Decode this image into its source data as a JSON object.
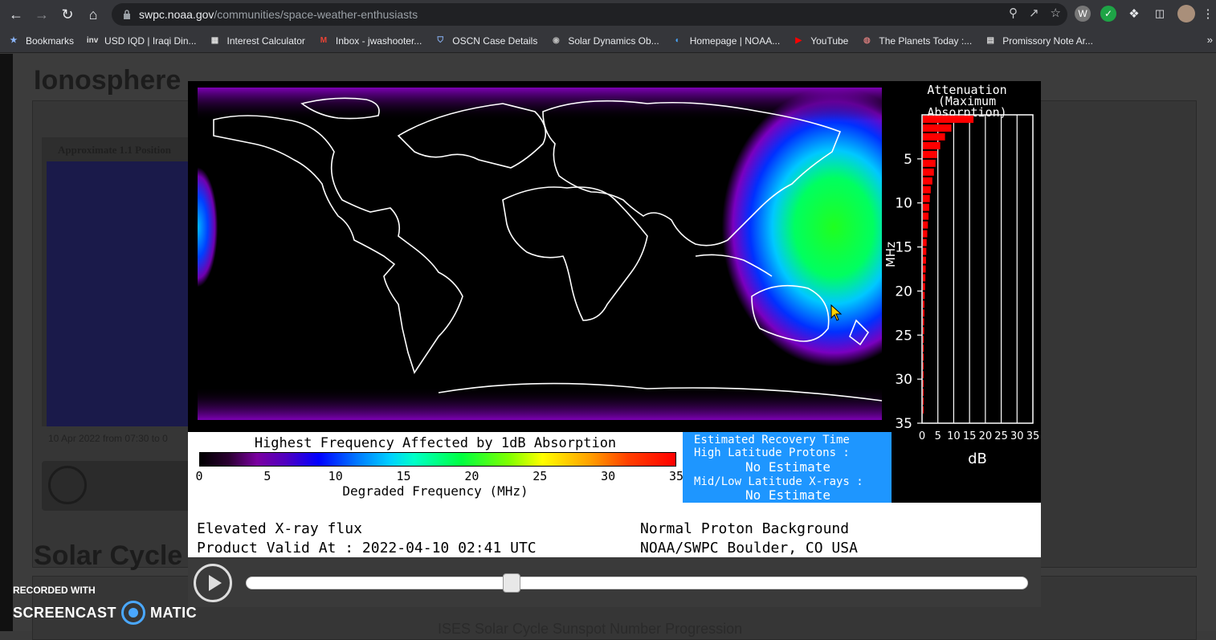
{
  "browser": {
    "url_host": "swpc.noaa.gov",
    "url_path": "/communities/space-weather-enthusiasts",
    "bookmarks": [
      {
        "label": "Bookmarks",
        "icon": "star-icon"
      },
      {
        "label": "USD IQD | Iraqi Din...",
        "icon": "inv-icon"
      },
      {
        "label": "Interest Calculator",
        "icon": "calculator-icon"
      },
      {
        "label": "Inbox - jwashooter...",
        "icon": "gmail-icon"
      },
      {
        "label": "OSCN Case Details",
        "icon": "shield-icon"
      },
      {
        "label": "Solar Dynamics Ob...",
        "icon": "nasa-icon"
      },
      {
        "label": "Homepage | NOAA...",
        "icon": "noaa-icon"
      },
      {
        "label": "YouTube",
        "icon": "youtube-icon"
      },
      {
        "label": "The Planets Today :...",
        "icon": "planet-icon"
      },
      {
        "label": "Promissory Note Ar...",
        "icon": "document-icon"
      }
    ],
    "more": "»"
  },
  "page": {
    "section1_title": "Ionosphere",
    "inner_title": "Approximate 1.1 Position",
    "inner_date": "10 Apr 2022 from 07:30 to 0",
    "section2_title": "Solar Cycle",
    "section2_sub": "ISES Solar Cycle Sunspot Number Progression"
  },
  "drap": {
    "attenuation_title": "Attenuation",
    "attenuation_subtitle": "(Maximum Absorption)",
    "yaxis_label": "MHz",
    "yticks": [
      "5",
      "10",
      "15",
      "20",
      "25",
      "30",
      "35"
    ],
    "xticks": [
      "0",
      "5",
      "10",
      "15",
      "20",
      "25",
      "30",
      "35"
    ],
    "xaxis_label": "dB",
    "legend_title": "Highest Frequency Affected by 1dB Absorption",
    "colorbar_ticks": [
      "0",
      "5",
      "10",
      "15",
      "20",
      "25",
      "30",
      "35"
    ],
    "colorbar_label": "Degraded Frequency (MHz)",
    "recovery_title": "Estimated Recovery Time",
    "high_lat_label": "High Latitude Protons :",
    "high_lat_value": "No Estimate",
    "mid_lat_label": "Mid/Low Latitude X-rays :",
    "mid_lat_value": "No Estimate",
    "status_left": "Elevated X-ray flux",
    "valid_at": "Product Valid At : 2022-04-10 02:41 UTC",
    "status_right": "Normal Proton Background",
    "source": "NOAA/SWPC Boulder, CO USA",
    "slider_position": 0.34,
    "colors": {
      "recovery_bg": "#1e96ff",
      "bar": "#ff0000"
    }
  },
  "attenuation_bars_db": [
    16,
    9,
    7,
    5.5,
    4.5,
    4,
    3.5,
    3,
    2.5,
    2.2,
    2,
    1.8,
    1.6,
    1.4,
    1.2,
    1.1,
    1,
    0.9,
    0.8,
    0.7,
    0.6,
    0.5,
    0.5,
    0.4,
    0.4,
    0.3,
    0.3,
    0.3,
    0.2,
    0.2,
    0.2,
    0.2,
    0.1,
    0.1
  ],
  "watermark": {
    "top": "RECORDED WITH",
    "left": "SCREENCAST",
    "right": "MATIC"
  }
}
